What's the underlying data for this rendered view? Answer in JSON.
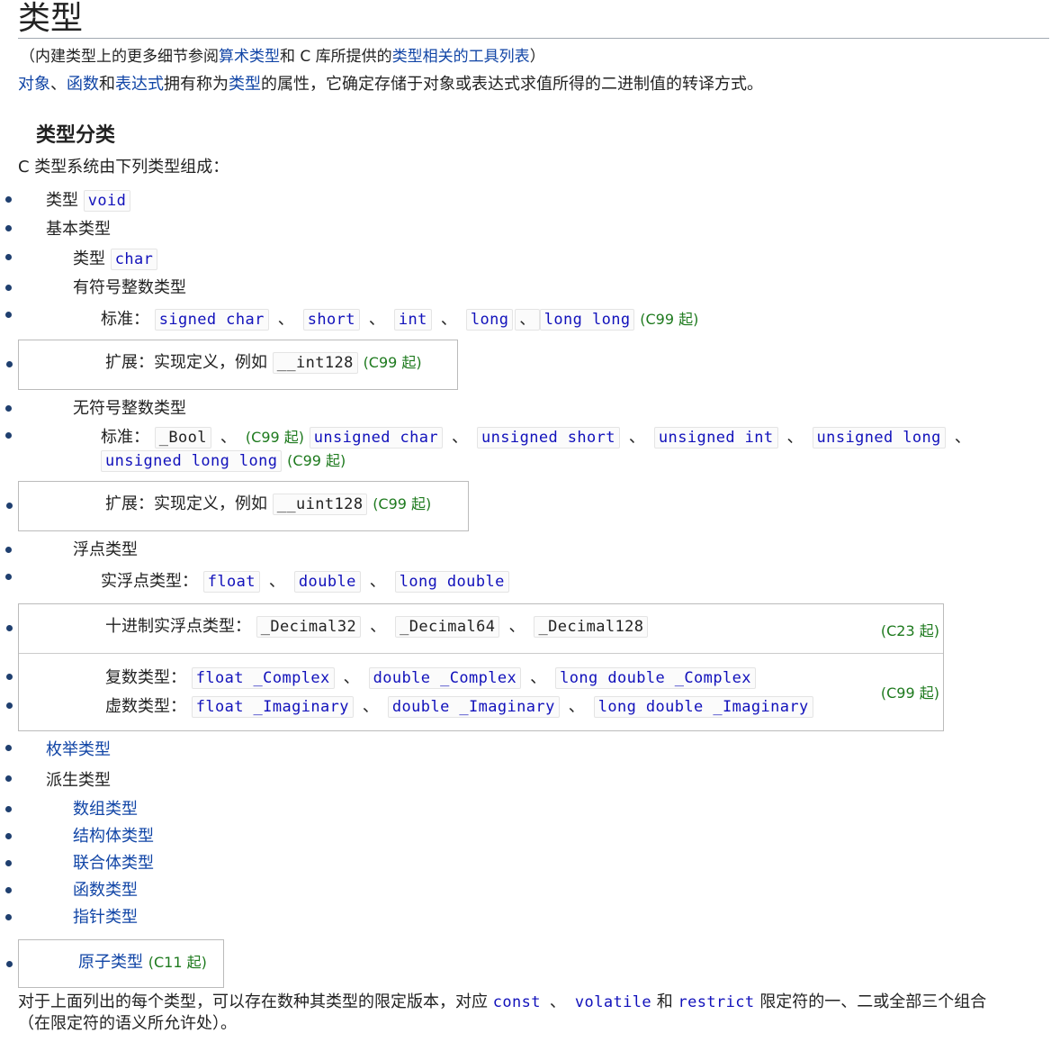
{
  "title": "类型",
  "note": {
    "prefix": "（内建类型上的更多细节参阅",
    "link1": "算术类型",
    "mid": "和 C 库所提供的",
    "link2": "类型相关的工具列表",
    "suffix": "）"
  },
  "intro": {
    "link1": "对象",
    "sep1": "、",
    "link2": "函数",
    "and": "和",
    "link3": "表达式",
    "text1": "拥有称为",
    "link4": "类型",
    "text2": "的属性，它确定存储于对象或表达式求值所得的二进制值的转译方式。"
  },
  "section": {
    "heading": "类型分类",
    "lead": "C 类型系统由下列类型组成：",
    "void_label": "类型",
    "void_code": "void",
    "basic_label": "基本类型",
    "char_label": "类型",
    "char_code": "char",
    "signed_label": "有符号整数类型",
    "standard_label": "标准：",
    "signed_types": [
      "signed char",
      "short",
      "int",
      "long",
      "long long"
    ],
    "ext_label": "扩展：实现定义，例如",
    "int128": "__int128",
    "unsigned_label": "无符号整数类型",
    "bool": "_Bool",
    "unsigned_types": [
      "unsigned char",
      "unsigned short",
      "unsigned int",
      "unsigned long",
      "unsigned long long"
    ],
    "uint128": "__uint128",
    "float_label": "浮点类型",
    "real_float_label": "实浮点类型：",
    "real_float_types": [
      "float",
      "double",
      "long double"
    ],
    "decimal_label": "十进制实浮点类型：",
    "decimal_types": [
      "_Decimal32",
      "_Decimal64",
      "_Decimal128"
    ],
    "complex_label": "复数类型：",
    "complex_types": [
      "float _Complex",
      "double _Complex",
      "long double _Complex"
    ],
    "imaginary_label": "虚数类型：",
    "imaginary_types": [
      "float _Imaginary",
      "double _Imaginary",
      "long double _Imaginary"
    ],
    "enum_link": "枚举类型",
    "derived_label": "派生类型",
    "derived_links": [
      "数组类型",
      "结构体类型",
      "联合体类型",
      "函数类型",
      "指针类型"
    ],
    "atomic_link": "原子类型",
    "sep": "、",
    "c99": "(C99 起)",
    "c11": "(C11 起)",
    "c23": "(C23 起)",
    "footer1": "对于上面列出的每个类型，可以存在数种其类型的限定版本，对应",
    "q_const": "const",
    "q_volatile": "volatile",
    "and": "和",
    "q_restrict": "restrict",
    "footer2": "限定符的一、二或全部三个组合",
    "footer3": "（在限定符的语义所允许处）。"
  }
}
